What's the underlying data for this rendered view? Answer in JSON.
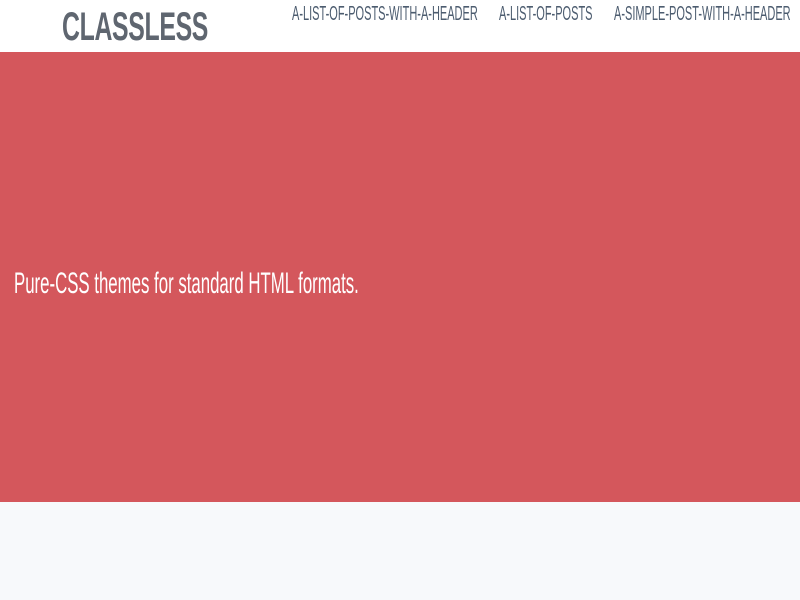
{
  "header": {
    "site_title": "CLASSLESS",
    "nav": [
      {
        "label": "A-LIST-OF-POSTS-WITH-A-HEADER"
      },
      {
        "label": "A-LIST-OF-POSTS"
      },
      {
        "label": "A-SIMPLE-POST-WITH-A-HEADER"
      }
    ]
  },
  "hero": {
    "tagline": "Pure-CSS themes for standard HTML formats."
  },
  "colors": {
    "hero_background": "#d4575c",
    "header_background": "#ffffff",
    "page_background": "#f7f9fb",
    "logo_color": "#5f6670",
    "nav_color": "#4c5c6f"
  }
}
